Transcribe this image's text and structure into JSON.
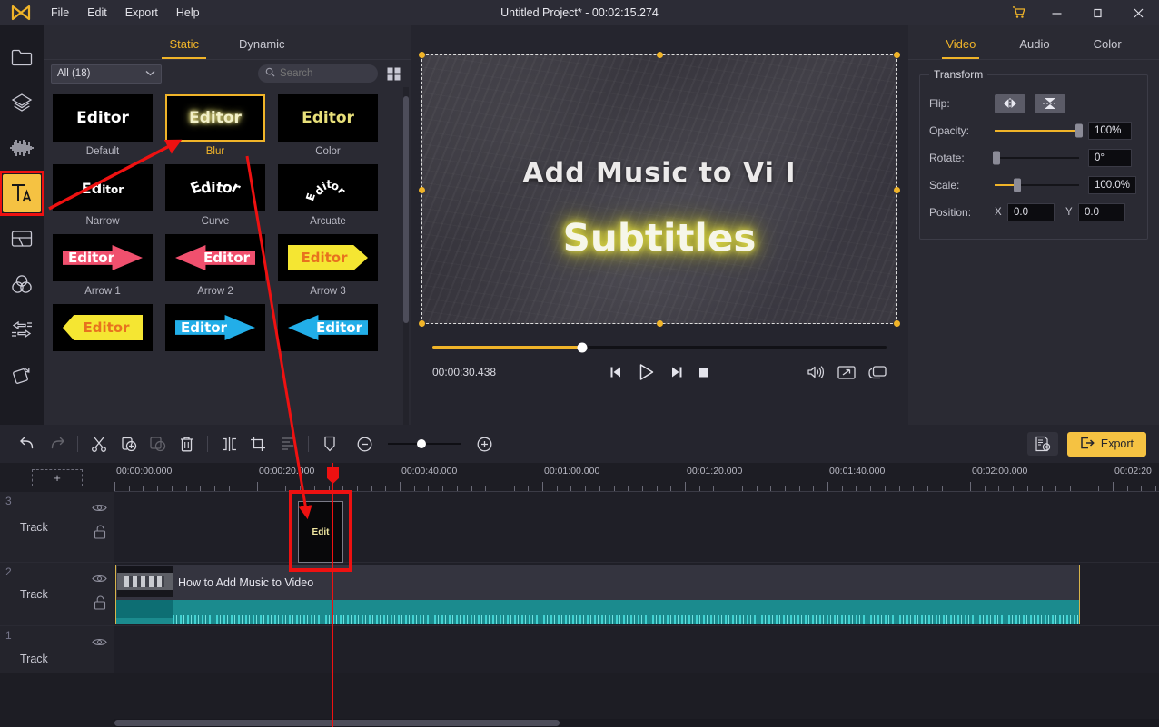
{
  "app": {
    "title": "Untitled Project* - 00:02:15.274",
    "accent": "#f0b429",
    "annotation_color": "#ee1111"
  },
  "menubar": {
    "logo_icon": "wondershare-logo-icon",
    "items": [
      {
        "label": "File"
      },
      {
        "label": "Edit"
      },
      {
        "label": "Export"
      },
      {
        "label": "Help"
      }
    ],
    "window_controls": {
      "cart_icon": "shopping-cart-icon",
      "minimize_icon": "minimize-icon",
      "maximize_icon": "maximize-icon",
      "close_icon": "close-icon"
    }
  },
  "rail": {
    "items": [
      {
        "name": "media",
        "icon": "folder-icon",
        "active": false
      },
      {
        "name": "effects",
        "icon": "layers-icon",
        "active": false
      },
      {
        "name": "audio",
        "icon": "audio-waveform-icon",
        "active": false
      },
      {
        "name": "text",
        "icon": "text-ta-icon",
        "active": true
      },
      {
        "name": "split-screen",
        "icon": "split-screen-icon",
        "active": false
      },
      {
        "name": "color",
        "icon": "color-circles-icon",
        "active": false
      },
      {
        "name": "transition",
        "icon": "transition-arrows-icon",
        "active": false
      },
      {
        "name": "element",
        "icon": "rotate-element-icon",
        "active": false
      }
    ]
  },
  "library": {
    "tabs": [
      {
        "label": "Static",
        "active": true
      },
      {
        "label": "Dynamic",
        "active": false
      }
    ],
    "category": "All (18)",
    "category_chevron_icon": "chevron-down-icon",
    "search": {
      "value": "",
      "placeholder": "Search",
      "icon": "search-icon"
    },
    "grid_toggle_icon": "grid-view-icon",
    "presets": [
      {
        "label": "Default",
        "sample": "Editor",
        "style": "default",
        "selected": false
      },
      {
        "label": "Blur",
        "sample": "Editor",
        "style": "blur",
        "selected": true
      },
      {
        "label": "Color",
        "sample": "Editor",
        "style": "color",
        "selected": false
      },
      {
        "label": "Narrow",
        "sample": "Editor",
        "style": "narrow",
        "selected": false
      },
      {
        "label": "Curve",
        "sample": "Editor",
        "style": "curve",
        "selected": false
      },
      {
        "label": "Arcuate",
        "sample": "Editor",
        "style": "arcuate",
        "selected": false
      },
      {
        "label": "Arrow 1",
        "sample": "Editor",
        "style": "arrow-right-pink",
        "selected": false
      },
      {
        "label": "Arrow 2",
        "sample": "Editor",
        "style": "arrow-left-pink",
        "selected": false
      },
      {
        "label": "Arrow 3",
        "sample": "Editor",
        "style": "banner-yellow",
        "selected": false
      },
      {
        "label": "",
        "sample": "Editor",
        "style": "banner-left-yellow",
        "selected": false
      },
      {
        "label": "",
        "sample": "Editor",
        "style": "arrow-right-blue",
        "selected": false
      },
      {
        "label": "",
        "sample": "Editor",
        "style": "arrow-left-blue",
        "selected": false
      }
    ]
  },
  "preview": {
    "title_text": "Add Music to Vi I",
    "subtitle_text": "Subtitles",
    "timecode": "00:00:30.438",
    "progress_percent": 33,
    "controls": [
      {
        "name": "previous-frame",
        "icon": "previous-frame-icon"
      },
      {
        "name": "play",
        "icon": "play-icon"
      },
      {
        "name": "next-frame",
        "icon": "next-frame-icon"
      },
      {
        "name": "stop",
        "icon": "stop-icon"
      }
    ],
    "right_controls": [
      {
        "name": "volume",
        "icon": "volume-icon"
      },
      {
        "name": "fullscreen",
        "icon": "fullscreen-icon"
      },
      {
        "name": "snapshot",
        "icon": "snapshot-icon"
      }
    ]
  },
  "properties": {
    "tabs": [
      {
        "label": "Video",
        "active": true
      },
      {
        "label": "Audio",
        "active": false
      },
      {
        "label": "Color",
        "active": false
      }
    ],
    "transform": {
      "legend": "Transform",
      "flip": {
        "label": "Flip:",
        "horizontal_icon": "flip-horizontal-icon",
        "vertical_icon": "flip-vertical-icon"
      },
      "opacity": {
        "label": "Opacity:",
        "value": "100%",
        "percent": 100
      },
      "rotate": {
        "label": "Rotate:",
        "value": "0°",
        "percent": 2
      },
      "scale": {
        "label": "Scale:",
        "value": "100.0%",
        "percent": 27
      },
      "position": {
        "label": "Position:",
        "x_label": "X",
        "x_value": "0.0",
        "y_label": "Y",
        "y_value": "0.0"
      }
    }
  },
  "toolbar": {
    "tools": [
      {
        "name": "undo",
        "icon": "undo-icon",
        "disabled": false
      },
      {
        "name": "redo",
        "icon": "redo-icon",
        "disabled": true
      },
      {
        "name": "cut",
        "icon": "scissors-icon",
        "disabled": false
      },
      {
        "name": "add-to-timeline",
        "icon": "add-circle-icon",
        "disabled": false
      },
      {
        "name": "copy",
        "icon": "copy-icon",
        "disabled": true
      },
      {
        "name": "delete",
        "icon": "trash-icon",
        "disabled": false
      },
      {
        "name": "split",
        "icon": "split-icon",
        "disabled": false
      },
      {
        "name": "crop",
        "icon": "crop-icon",
        "disabled": false
      },
      {
        "name": "audio-mixer",
        "icon": "mixer-icon",
        "disabled": true
      },
      {
        "name": "marker",
        "icon": "marker-icon",
        "disabled": false
      }
    ],
    "zoom_out_icon": "zoom-out-icon",
    "zoom_in_icon": "zoom-in-icon",
    "zoom_percent": 46,
    "settings_icon": "render-settings-icon",
    "export": {
      "label": "Export",
      "icon": "export-icon"
    }
  },
  "timeline": {
    "add_track_label": "+",
    "ruler_labels": [
      "00:00:00.000",
      "00:00:20.000",
      "00:00:40.000",
      "00:01:00.000",
      "00:01:20.000",
      "00:01:40.000",
      "00:02:00.000",
      "00:02:20"
    ],
    "tracks": [
      {
        "num": "3",
        "name": "Track",
        "eye_icon": "eye-icon",
        "lock_icon": "unlock-icon"
      },
      {
        "num": "2",
        "name": "Track",
        "eye_icon": "eye-icon",
        "lock_icon": "unlock-icon"
      },
      {
        "num": "1",
        "name": "Track",
        "eye_icon": "eye-icon",
        "lock_icon": "unlock-icon"
      }
    ],
    "text_clip": {
      "label": "Edit"
    },
    "video_clip": {
      "title": "How to Add Music to Video"
    }
  }
}
